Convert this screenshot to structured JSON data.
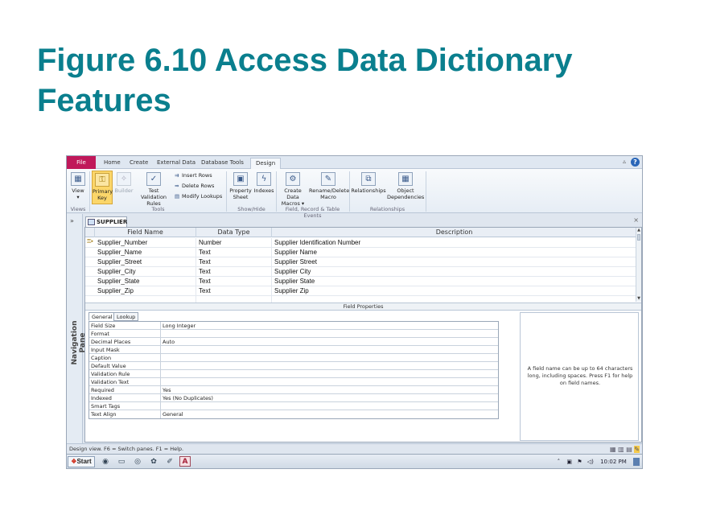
{
  "slide": {
    "title": "Figure 6.10 Access Data Dictionary Features"
  },
  "tabs": {
    "file": "File",
    "home": "Home",
    "create": "Create",
    "external": "External Data",
    "dbtools": "Database Tools",
    "design": "Design"
  },
  "ribbon": {
    "view": "View",
    "primary_key_1": "Primary",
    "primary_key_2": "Key",
    "builder": "Builder",
    "test_rules_1": "Test Validation",
    "test_rules_2": "Rules",
    "insert_rows": "Insert Rows",
    "delete_rows": "Delete Rows",
    "modify_lookups": "Modify Lookups",
    "property_sheet_1": "Property",
    "property_sheet_2": "Sheet",
    "indexes": "Indexes",
    "create_macros_1": "Create Data",
    "create_macros_2": "Macros",
    "rename_macro_1": "Rename/Delete",
    "rename_macro_2": "Macro",
    "relationships": "Relationships",
    "object_deps_1": "Object",
    "object_deps_2": "Dependencies",
    "groups": {
      "views": "Views",
      "tools": "Tools",
      "showhide": "Show/Hide",
      "events": "Field, Record & Table Events",
      "relationships": "Relationships"
    }
  },
  "nav": {
    "toggle": "»",
    "label": "Navigation Pane"
  },
  "document": {
    "tab": "SUPPLIER",
    "close": "×"
  },
  "grid": {
    "headers": {
      "field": "Field Name",
      "type": "Data Type",
      "desc": "Description"
    },
    "rows": [
      {
        "field": "Supplier_Number",
        "type": "Number",
        "desc": "Supplier Identification Number"
      },
      {
        "field": "Supplier_Name",
        "type": "Text",
        "desc": "Supplier Name"
      },
      {
        "field": "Supplier_Street",
        "type": "Text",
        "desc": "Supplier Street"
      },
      {
        "field": "Supplier_City",
        "type": "Text",
        "desc": "Supplier City"
      },
      {
        "field": "Supplier_State",
        "type": "Text",
        "desc": "Supplier State"
      },
      {
        "field": "Supplier_Zip",
        "type": "Text",
        "desc": "Supplier Zip"
      }
    ]
  },
  "field_properties": {
    "title": "Field Properties",
    "tab_general": "General",
    "tab_lookup": "Lookup",
    "rows": [
      {
        "label": "Field Size",
        "value": "Long Integer"
      },
      {
        "label": "Format",
        "value": ""
      },
      {
        "label": "Decimal Places",
        "value": "Auto"
      },
      {
        "label": "Input Mask",
        "value": ""
      },
      {
        "label": "Caption",
        "value": ""
      },
      {
        "label": "Default Value",
        "value": ""
      },
      {
        "label": "Validation Rule",
        "value": ""
      },
      {
        "label": "Validation Text",
        "value": ""
      },
      {
        "label": "Required",
        "value": "Yes"
      },
      {
        "label": "Indexed",
        "value": "Yes (No Duplicates)"
      },
      {
        "label": "Smart Tags",
        "value": ""
      },
      {
        "label": "Text Align",
        "value": "General"
      }
    ],
    "help": "A field name can be up to 64 characters long, including spaces. Press F1 for help on field names."
  },
  "status": {
    "text": "Design view.  F6 = Switch panes.  F1 = Help."
  },
  "taskbar": {
    "start": "Start",
    "clock": "10:02 PM"
  }
}
